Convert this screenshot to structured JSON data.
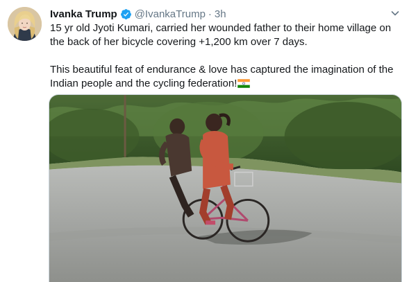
{
  "tweet": {
    "author": {
      "display_name": "Ivanka Trump",
      "handle": "@IvankaTrump",
      "separator": "·",
      "time": "3h",
      "verified_icon": "verified-badge-icon",
      "avatar_icon": "user-avatar"
    },
    "menu_icon": "chevron-down-icon",
    "body": {
      "paragraph_1": "15 yr old Jyoti Kumari, carried her wounded father to their home village on the back of her bicycle covering +1,200 km over 7 days.",
      "paragraph_2": "This beautiful feat of endurance & love has captured the imagination of the Indian people and the cycling federation!",
      "emoji": "india-flag-icon"
    },
    "media": {
      "type": "photo",
      "subject": "girl-on-bicycle-carrying-father-photo"
    }
  },
  "colors": {
    "text": "#14171a",
    "secondary": "#657786",
    "verified": "#1da1f2",
    "border": "#ccd6dd"
  }
}
